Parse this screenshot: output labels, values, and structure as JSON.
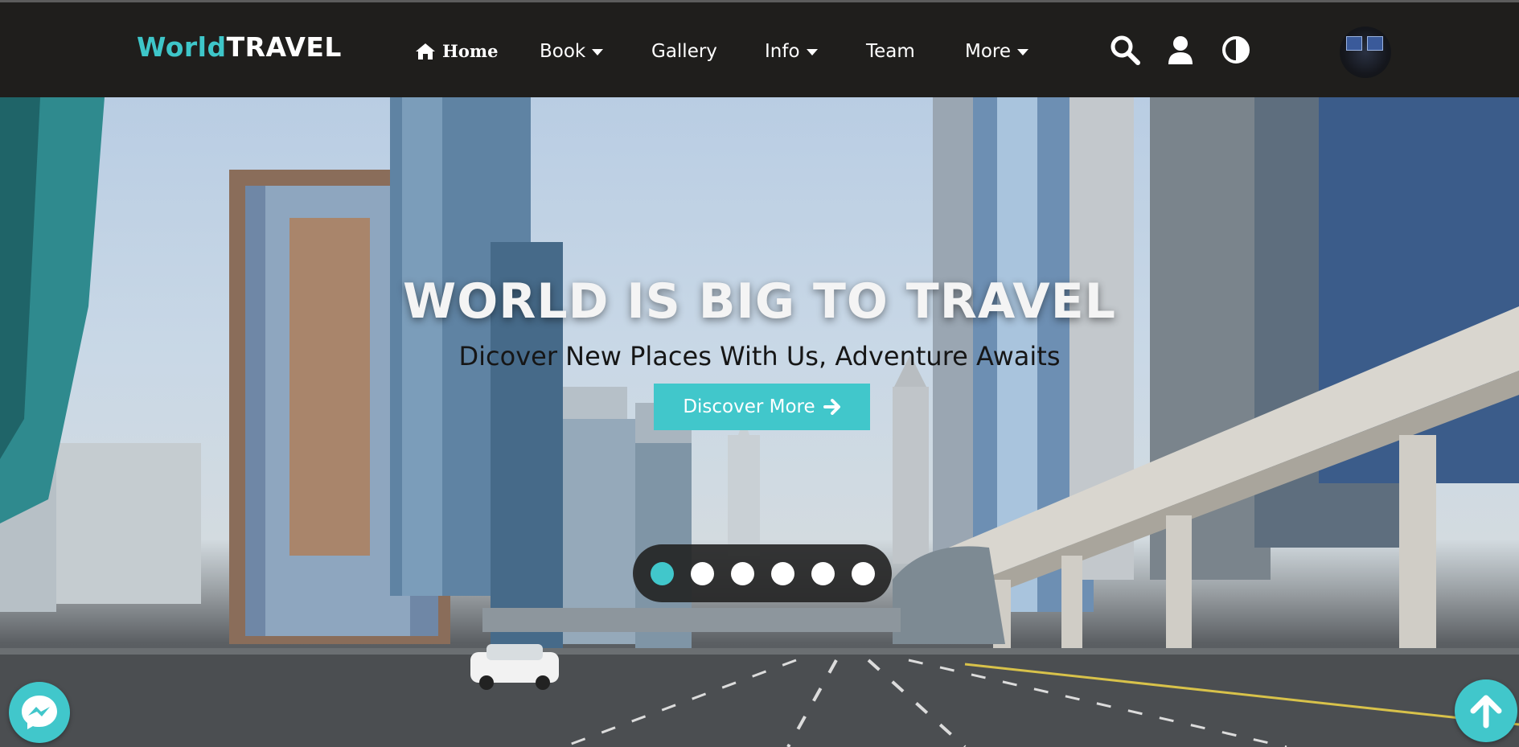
{
  "brand": {
    "part1": "World",
    "part2": "TRAVEL",
    "accent_color": "#41c7cb"
  },
  "nav": {
    "items": [
      {
        "label": "Home",
        "icon": "home-icon"
      },
      {
        "label": "Book",
        "dropdown": true
      },
      {
        "label": "Gallery"
      },
      {
        "label": "Info",
        "dropdown": true
      },
      {
        "label": "Team"
      },
      {
        "label": "More",
        "dropdown": true
      }
    ],
    "icons": [
      "search-icon",
      "user-icon",
      "contrast-icon"
    ],
    "avatar": "avatar"
  },
  "hero": {
    "title": "WORLD IS BIG TO TRAVEL",
    "subtitle": "Dicover New Places With Us, Adventure Awaits",
    "cta_label": "Discover More",
    "cta_icon": "arrow-right-icon",
    "slides": {
      "count": 6,
      "active": 1
    }
  },
  "floating": {
    "messenger_icon": "messenger-icon",
    "scroll_top_icon": "arrow-up-icon"
  }
}
